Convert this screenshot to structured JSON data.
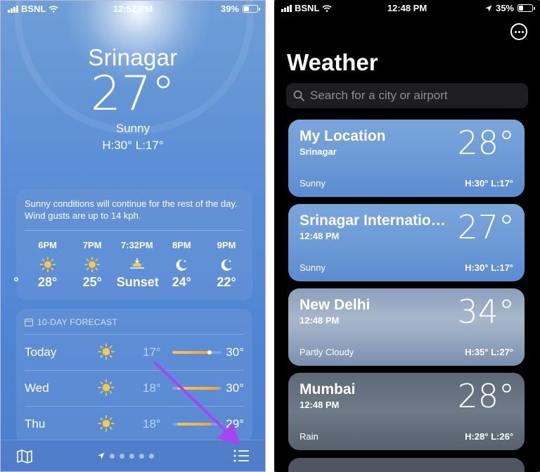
{
  "left": {
    "status": {
      "carrier": "BSNL",
      "time": "12:52 PM",
      "battery": "39%",
      "battery_level": 0.39
    },
    "location": {
      "city": "Srinagar",
      "temp": "27°",
      "condition": "Sunny",
      "hilo": "H:30°  L:17°"
    },
    "hourly": {
      "summary": "Sunny conditions will continue for the rest of the day. Wind gusts are up to 14 kph.",
      "items": [
        {
          "time": "",
          "icon": "sun-icon",
          "temp": "°"
        },
        {
          "time": "6PM",
          "icon": "sun-icon",
          "temp": "28°"
        },
        {
          "time": "7PM",
          "icon": "sun-icon",
          "temp": "25°"
        },
        {
          "time": "7:32PM",
          "icon": "sunset-icon",
          "temp": "Sunset"
        },
        {
          "time": "8PM",
          "icon": "moon-stars-icon",
          "temp": "24°"
        },
        {
          "time": "9PM",
          "icon": "moon-stars-icon",
          "temp": "22°"
        }
      ]
    },
    "forecast": {
      "header": "10-DAY FORECAST",
      "days": [
        {
          "day": "Today",
          "icon": "sun-icon",
          "low": "17°",
          "high": "30°",
          "range_start": 0.0,
          "range_end": 0.75,
          "current": 0.72
        },
        {
          "day": "Wed",
          "icon": "sun-icon",
          "low": "18°",
          "high": "30°",
          "range_start": 0.1,
          "range_end": 0.95
        },
        {
          "day": "Thu",
          "icon": "sun-icon",
          "low": "18°",
          "high": "29°",
          "range_start": 0.1,
          "range_end": 0.8
        }
      ]
    },
    "bottom": {
      "map_icon": "map-icon",
      "location_icon": "location-arrow-icon",
      "list_icon": "list-icon",
      "page_dots": 5
    }
  },
  "right": {
    "status": {
      "carrier": "BSNL",
      "time": "12:48 PM",
      "battery": "35%",
      "battery_level": 0.35
    },
    "title": "Weather",
    "search": {
      "placeholder": "Search for a city or airport"
    },
    "locations": [
      {
        "name": "My Location",
        "sub": "Srinagar",
        "temp": "28°",
        "condition": "Sunny",
        "hilo": "H:30°  L:17°",
        "style": "sunny"
      },
      {
        "name": "Srinagar International Airport",
        "sub": "12:48 PM",
        "temp": "27°",
        "condition": "Sunny",
        "hilo": "H:30°  L:17°",
        "style": "sunny"
      },
      {
        "name": "New Delhi",
        "sub": "12:48 PM",
        "temp": "34°",
        "condition": "Partly Cloudy",
        "hilo": "H:35°  L:27°",
        "style": "cloudy"
      },
      {
        "name": "Mumbai",
        "sub": "12:48 PM",
        "temp": "28°",
        "condition": "Rain",
        "hilo": "H:28°  L:26°",
        "style": "rain"
      }
    ]
  },
  "colors": {
    "arrow": "#a347f0",
    "sun": "#f7c948",
    "search_bg": "#1e1e21"
  }
}
